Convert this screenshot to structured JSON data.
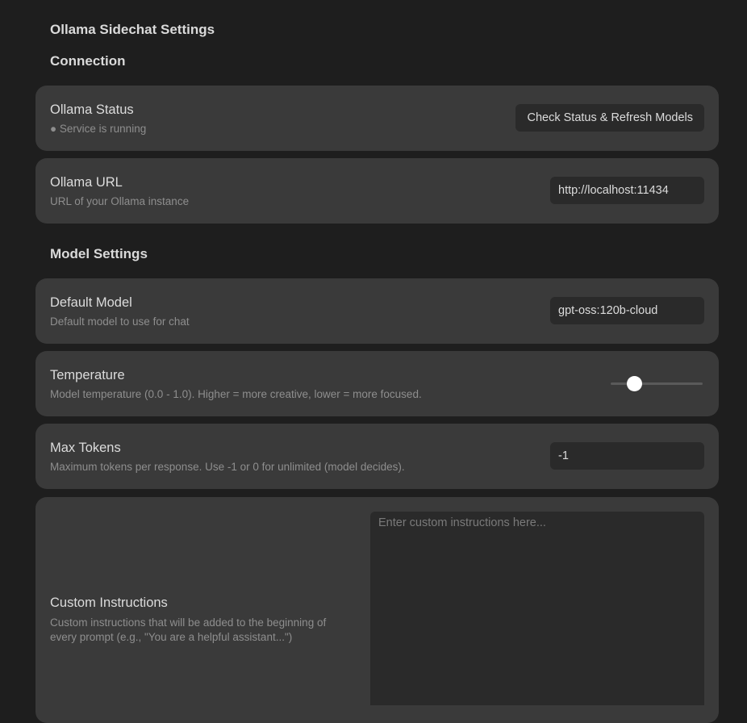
{
  "page": {
    "title": "Ollama Sidechat Settings"
  },
  "sections": {
    "connection": "Connection",
    "model_settings": "Model Settings"
  },
  "ollama_status": {
    "name": "Ollama Status",
    "status_text": "● Service is running",
    "button_label": "Check Status & Refresh Models"
  },
  "ollama_url": {
    "name": "Ollama URL",
    "desc": "URL of your Ollama instance",
    "value": "http://localhost:11434"
  },
  "default_model": {
    "name": "Default Model",
    "desc": "Default model to use for chat",
    "value": "gpt-oss:120b-cloud"
  },
  "temperature": {
    "name": "Temperature",
    "desc": "Model temperature (0.0 - 1.0). Higher = more creative, lower = more focused.",
    "value": 0.25
  },
  "max_tokens": {
    "name": "Max Tokens",
    "desc": "Maximum tokens per response. Use -1 or 0 for unlimited (model decides).",
    "value": "-1"
  },
  "custom_instructions": {
    "name": "Custom Instructions",
    "desc": "Custom instructions that will be added to the beginning of every prompt (e.g., \"You are a helpful assistant...\")",
    "placeholder": "Enter custom instructions here...",
    "value": ""
  },
  "colors": {
    "background": "#1e1e1e",
    "card": "#3a3a3a",
    "control": "#2a2a2a",
    "text": "#dcdcdc",
    "muted": "#8e8e8e"
  }
}
